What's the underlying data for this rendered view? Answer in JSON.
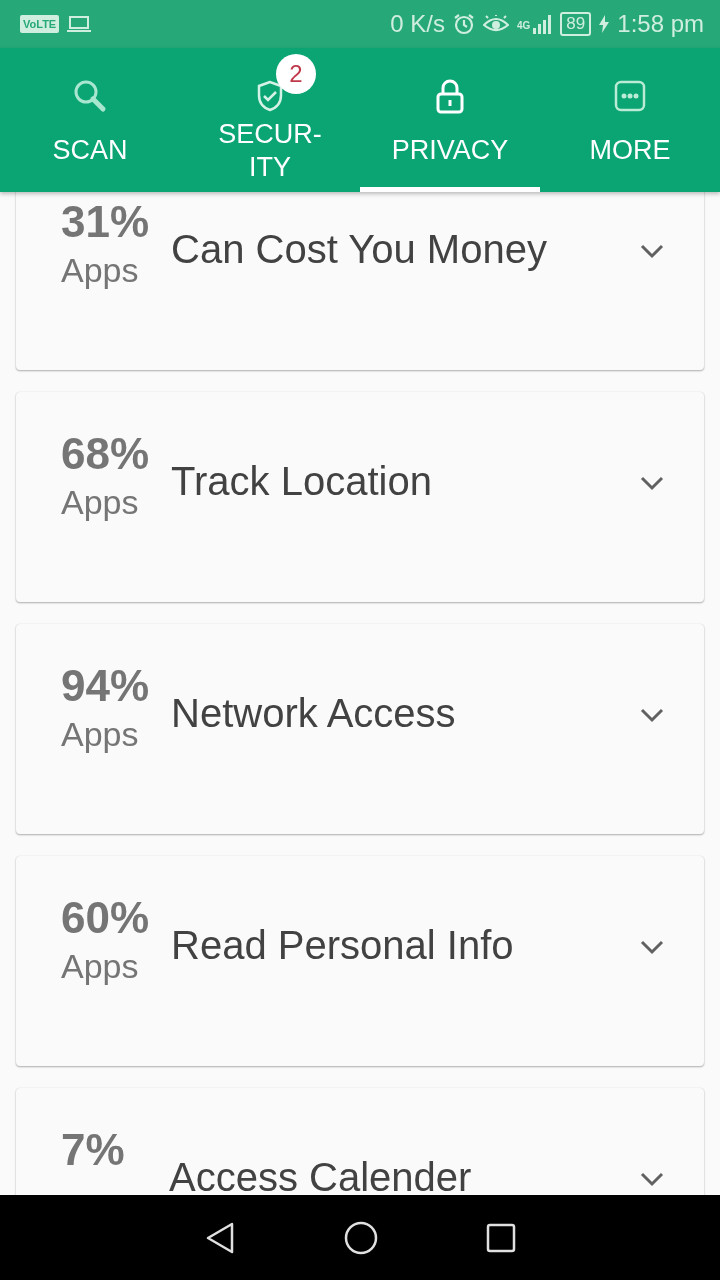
{
  "status_bar": {
    "badge": "VoLTE",
    "speed": "0 K/s",
    "network": "4G",
    "battery": "89",
    "time": "1:58 pm"
  },
  "tabs": [
    {
      "label": "SCAN",
      "kind": "search",
      "selected": false
    },
    {
      "label": "SECUR-\nITY",
      "kind": "security",
      "selected": false,
      "badge": "2"
    },
    {
      "label": "PRIVACY",
      "kind": "privacy",
      "selected": true
    },
    {
      "label": "MORE",
      "kind": "more",
      "selected": false
    }
  ],
  "permissions": [
    {
      "percent": "31%",
      "apps": "Apps",
      "title": "Can Cost You Money",
      "expanded": false
    },
    {
      "percent": "68%",
      "apps": "Apps",
      "title": "Track Location",
      "expanded": false
    },
    {
      "percent": "94%",
      "apps": "Apps",
      "title": "Network Access",
      "expanded": false
    },
    {
      "percent": "60%",
      "apps": "Apps",
      "title": "Read Personal Info",
      "expanded": false
    },
    {
      "percent": "7%",
      "title": "Access Calender",
      "expanded": false
    }
  ]
}
